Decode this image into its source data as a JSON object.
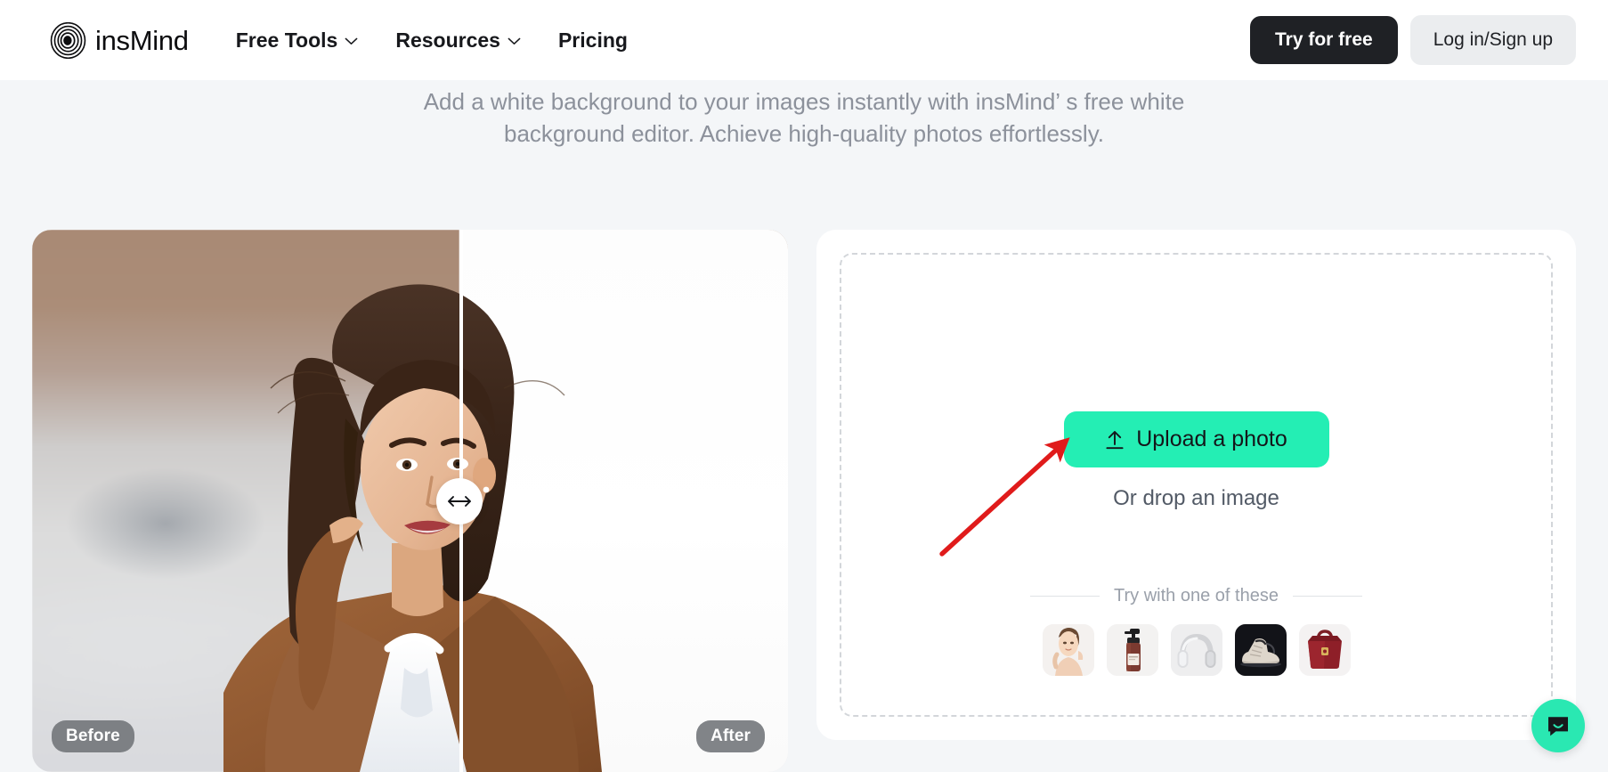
{
  "header": {
    "logo_text": "insMind",
    "logo_icon": "concentric-circles-logo",
    "nav": [
      {
        "label": "Free Tools",
        "has_chevron": true
      },
      {
        "label": "Resources",
        "has_chevron": true
      },
      {
        "label": "Pricing",
        "has_chevron": false
      }
    ],
    "try_for_free_label": "Try for free",
    "login_signup_label": "Log in/Sign up"
  },
  "hero": {
    "subtitle": "Add a white background to your images instantly with insMind’ s free white background editor. Achieve high-quality photos effortlessly."
  },
  "comparison": {
    "before_label": "Before",
    "after_label": "After",
    "handle_icon": "left-right-arrow-icon",
    "divider_position_percent": 56.5,
    "subject": "woman in brown blazer and white blouse"
  },
  "upload": {
    "button_label": "Upload a photo",
    "button_icon": "upload-arrow-icon",
    "button_color": "#24eeb4",
    "drop_text": "Or drop an image",
    "samples_label": "Try with one of these",
    "samples": [
      {
        "name": "sample-woman-skincare"
      },
      {
        "name": "sample-pump-bottle"
      },
      {
        "name": "sample-headphones"
      },
      {
        "name": "sample-sneaker"
      },
      {
        "name": "sample-red-handbag"
      }
    ]
  },
  "annotation": {
    "arrow_color": "#e01b1b",
    "points_to": "upload-a-photo-button"
  },
  "chat": {
    "icon": "chat-bubble-smile-icon",
    "color": "#2ae8b2"
  }
}
